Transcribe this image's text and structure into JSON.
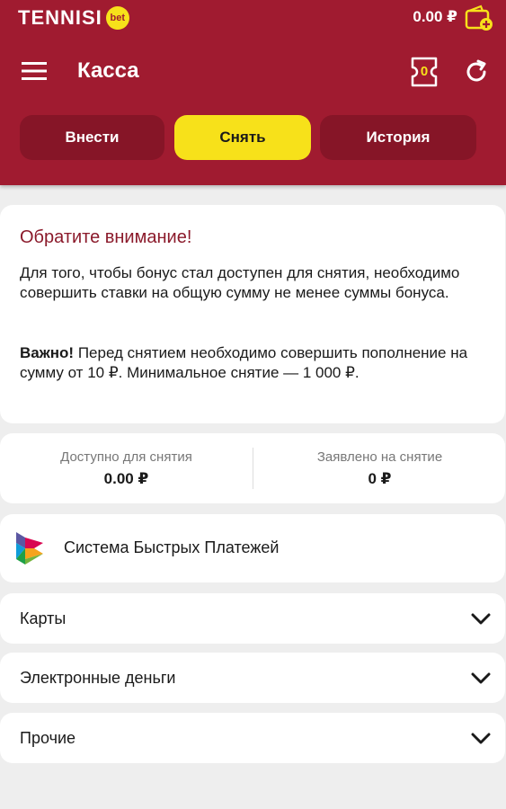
{
  "header": {
    "logo_text": "TENNISI",
    "logo_badge": "bet",
    "balance": "0.00 ₽",
    "page_title": "Касса",
    "coupon_count": "0"
  },
  "tabs": [
    {
      "label": "Внести",
      "active": false
    },
    {
      "label": "Снять",
      "active": true
    },
    {
      "label": "История",
      "active": false
    }
  ],
  "notice": {
    "title": "Обратите внимание!",
    "body": "Для того, чтобы бонус стал доступен для снятия, необходимо совершить ставки на общую сумму не менее суммы бонуса.",
    "important_label": "Важно!",
    "important_text": " Перед снятием необходимо совершить пополнение на сумму от 10 ₽. Минимальное снятие — 1 000 ₽."
  },
  "stats": {
    "available_label": "Доступно для снятия",
    "available_value": "0.00 ₽",
    "requested_label": "Заявлено на снятие",
    "requested_value": "0 ₽"
  },
  "payment_methods": {
    "sbp_label": "Система Быстрых Платежей",
    "accordion": [
      {
        "label": "Карты"
      },
      {
        "label": "Электронные деньги"
      },
      {
        "label": "Прочие"
      }
    ]
  },
  "colors": {
    "brand": "#a01b30",
    "tab_inactive": "#861527",
    "accent": "#f7e11a",
    "notice_title": "#8b1a2b"
  },
  "icons": [
    "menu-icon",
    "wallet-icon",
    "coupon-icon",
    "refresh-icon",
    "sbp-logo-icon",
    "chevron-down-icon"
  ]
}
